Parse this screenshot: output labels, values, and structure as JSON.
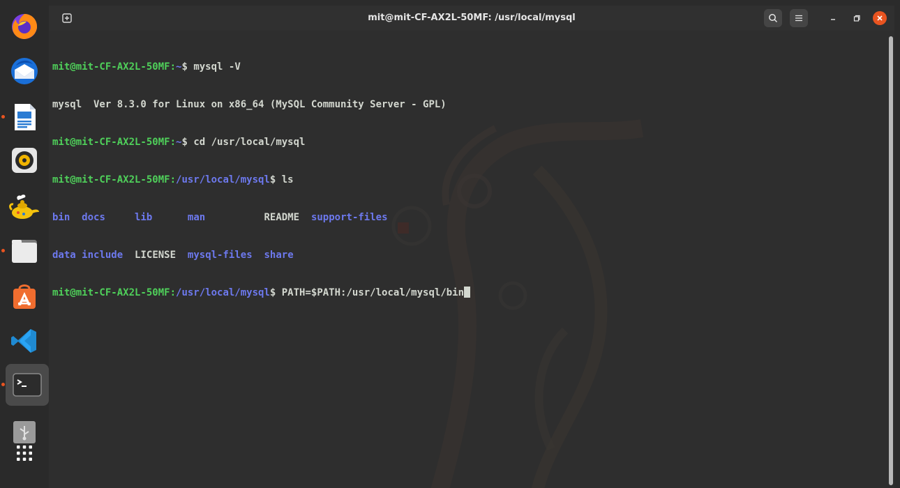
{
  "window": {
    "title": "mit@mit-CF-AX2L-50MF: /usr/local/mysql"
  },
  "dock": {
    "items": [
      {
        "name": "firefox",
        "icon": "firefox-icon"
      },
      {
        "name": "thunderbird",
        "icon": "thunderbird-icon"
      },
      {
        "name": "libreoffice-writer",
        "icon": "writer-icon"
      },
      {
        "name": "rhythmbox",
        "icon": "rhythmbox-icon"
      },
      {
        "name": "aladdin-lamp",
        "icon": "lamp-icon"
      },
      {
        "name": "files",
        "icon": "files-icon"
      },
      {
        "name": "ubuntu-software",
        "icon": "software-icon"
      },
      {
        "name": "vscode",
        "icon": "vscode-icon"
      },
      {
        "name": "terminal",
        "icon": "terminal-icon"
      },
      {
        "name": "usb-drive",
        "icon": "usb-icon"
      },
      {
        "name": "show-applications",
        "icon": "app-grid-icon"
      }
    ]
  },
  "terminal": {
    "prompt_user": "mit@mit-CF-AX2L-50MF",
    "prompt_sep": ":",
    "lines": [
      {
        "path": "~",
        "command": " mysql -V"
      },
      {
        "output": "mysql  Ver 8.3.0 for Linux on x86_64 (MySQL Community Server - GPL)"
      },
      {
        "path": "~",
        "command": " cd /usr/local/mysql"
      },
      {
        "path": "/usr/local/mysql",
        "command": " ls"
      },
      {
        "ls_row": [
          "bin",
          "docs",
          "lib",
          "man",
          "README",
          "support-files"
        ]
      },
      {
        "ls_row": [
          "data",
          "include",
          "LICENSE",
          "mysql-files",
          "share"
        ]
      },
      {
        "path": "/usr/local/mysql",
        "command": " PATH=$PATH:/usr/local/mysql/bin"
      }
    ],
    "dollar": "$"
  },
  "colors": {
    "prompt_user": "#4fd05a",
    "prompt_path": "#6d79ee",
    "text": "#d3d7cf",
    "accent_close": "#e95420",
    "background": "#2e2e2e"
  }
}
